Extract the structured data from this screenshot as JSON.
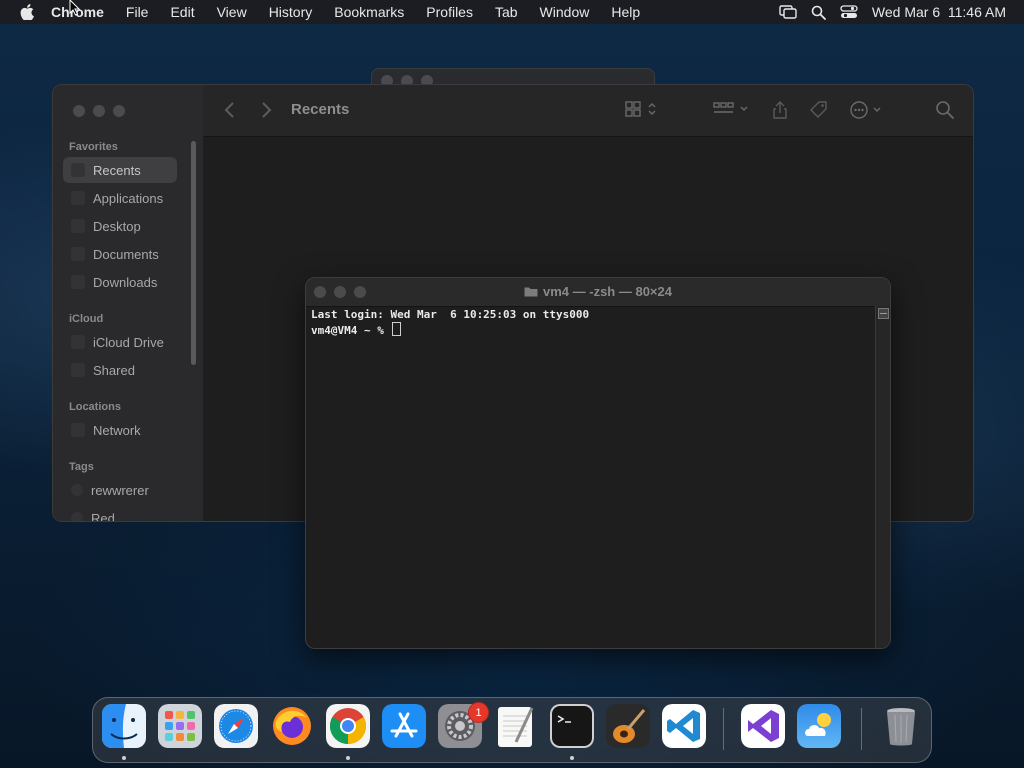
{
  "menubar": {
    "apple_icon": "apple-logo-icon",
    "app_name": "Chrome",
    "items": [
      "File",
      "Edit",
      "View",
      "History",
      "Bookmarks",
      "Profiles",
      "Tab",
      "Window",
      "Help"
    ],
    "status_icons": [
      "screen-mirroring-icon",
      "spotlight-search-icon",
      "control-center-icon"
    ],
    "clock": "Wed Mar 6  11:46 AM"
  },
  "finder": {
    "toolbar_title": "Recents",
    "sidebar": {
      "favorites_title": "Favorites",
      "favorites": [
        "Recents",
        "Applications",
        "Desktop",
        "Documents",
        "Downloads"
      ],
      "icloud_title": "iCloud",
      "icloud": [
        "iCloud Drive",
        "Shared"
      ],
      "locations_title": "Locations",
      "locations": [
        "Network"
      ],
      "tags_title": "Tags",
      "tags": [
        "rewwrerer",
        "Red"
      ],
      "selected": "Recents"
    }
  },
  "terminal": {
    "title": "vm4 — -zsh — 80×24",
    "lines": [
      "Last login: Wed Mar  6 10:25:03 on ttys000",
      "vm4@VM4 ~ % "
    ]
  },
  "dock": {
    "apps": [
      "Finder",
      "Launchpad",
      "Safari",
      "Firefox",
      "Google Chrome",
      "App Store",
      "System Settings",
      "TextEdit",
      "Terminal",
      "GarageBand",
      "Visual Studio Code"
    ],
    "recent_apps": [
      "Visual Studio",
      "Weather"
    ],
    "trash": "Trash",
    "system_settings_badge": "1"
  }
}
